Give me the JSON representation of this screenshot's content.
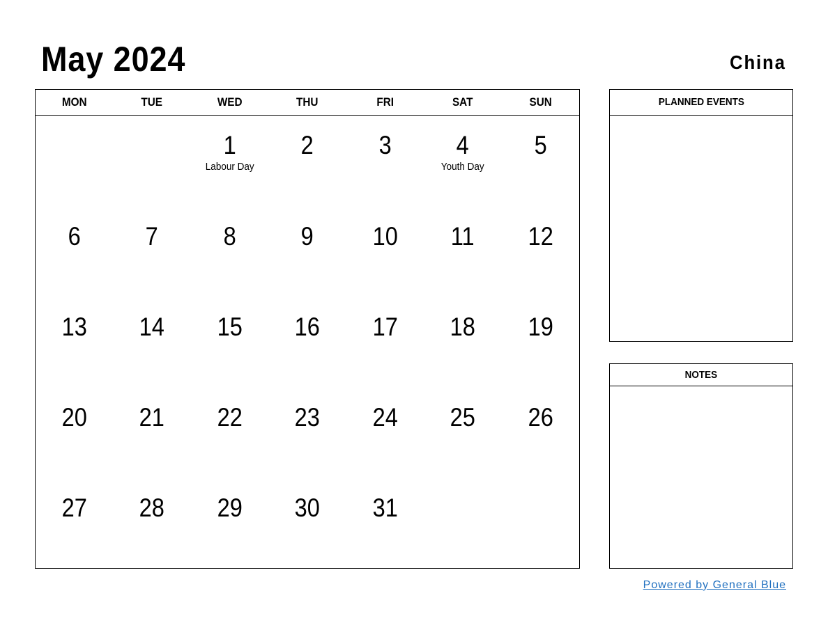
{
  "header": {
    "title": "May 2024",
    "country": "China"
  },
  "calendar": {
    "weekdays": [
      "MON",
      "TUE",
      "WED",
      "THU",
      "FRI",
      "SAT",
      "SUN"
    ],
    "weeks": [
      [
        {
          "d": ""
        },
        {
          "d": ""
        },
        {
          "d": "1",
          "h": "Labour Day"
        },
        {
          "d": "2"
        },
        {
          "d": "3"
        },
        {
          "d": "4",
          "h": "Youth Day"
        },
        {
          "d": "5"
        }
      ],
      [
        {
          "d": "6"
        },
        {
          "d": "7"
        },
        {
          "d": "8"
        },
        {
          "d": "9"
        },
        {
          "d": "10"
        },
        {
          "d": "11"
        },
        {
          "d": "12"
        }
      ],
      [
        {
          "d": "13"
        },
        {
          "d": "14"
        },
        {
          "d": "15"
        },
        {
          "d": "16"
        },
        {
          "d": "17"
        },
        {
          "d": "18"
        },
        {
          "d": "19"
        }
      ],
      [
        {
          "d": "20"
        },
        {
          "d": "21"
        },
        {
          "d": "22"
        },
        {
          "d": "23"
        },
        {
          "d": "24"
        },
        {
          "d": "25"
        },
        {
          "d": "26"
        }
      ],
      [
        {
          "d": "27"
        },
        {
          "d": "28"
        },
        {
          "d": "29"
        },
        {
          "d": "30"
        },
        {
          "d": "31"
        },
        {
          "d": ""
        },
        {
          "d": ""
        }
      ]
    ]
  },
  "panels": {
    "planned_events": "PLANNED EVENTS",
    "notes": "NOTES"
  },
  "footer": {
    "powered_by": "Powered by General Blue",
    "link_color": "#1f6fbf"
  }
}
